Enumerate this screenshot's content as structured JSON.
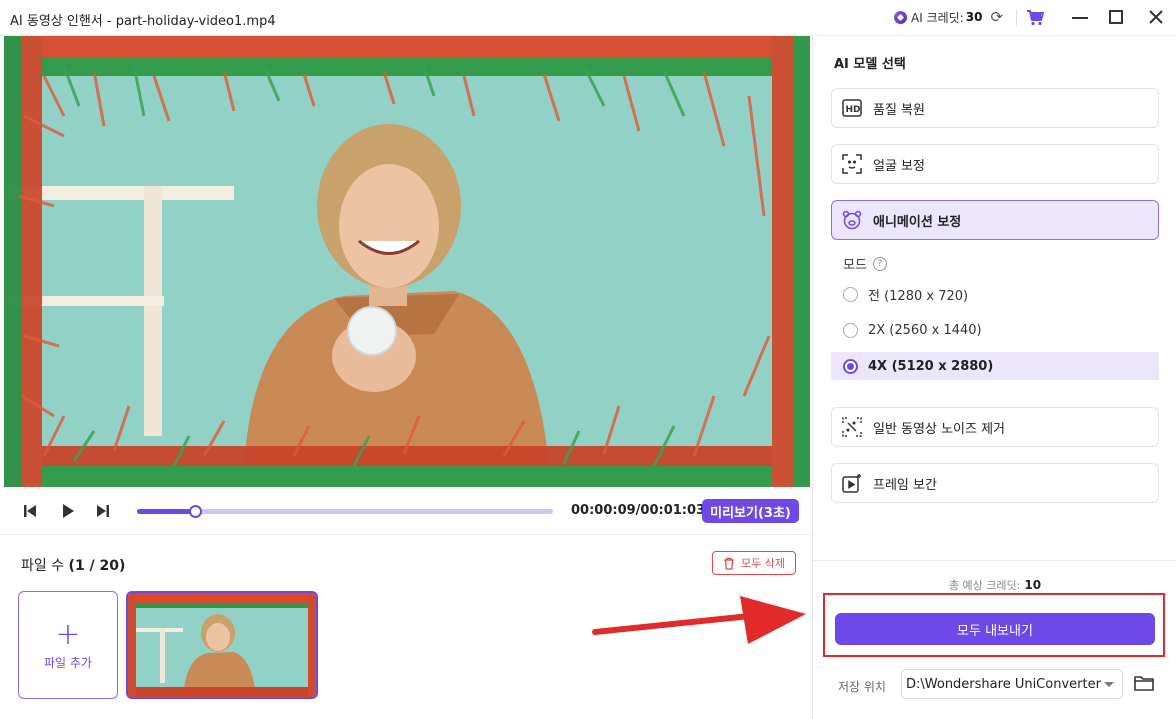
{
  "window": {
    "title": "AI 동영상 인핸서 - part-holiday-video1.mp4",
    "credit_label": "AI 크레딧:",
    "credit_value": "30"
  },
  "player": {
    "time": "00:00:09/00:01:03",
    "preview_label": "미리보기(3초)",
    "progress_fraction": 0.14
  },
  "files": {
    "count_label": "파일 수",
    "count_value": "(1 / 20)",
    "delete_all_label": "모두 삭제",
    "add_file_label": "파일 추가"
  },
  "panel": {
    "title": "AI 모델 선택",
    "models": [
      {
        "label": "품질 복원",
        "icon": "hd-icon"
      },
      {
        "label": "얼굴 보정",
        "icon": "face-scan-icon"
      },
      {
        "label": "애니메이션 보정",
        "icon": "bear-face-icon"
      },
      {
        "label": "일반 동영상 노이즈 제거",
        "icon": "denoise-icon"
      },
      {
        "label": "프레임 보간",
        "icon": "frame-interpolation-icon"
      }
    ],
    "mode_label": "모드",
    "modes": [
      {
        "label": "전 (1280 x 720)"
      },
      {
        "label": "2X (2560 x 1440)"
      },
      {
        "label": "4X (5120 x 2880)"
      }
    ],
    "selected_model": "애니메이션 보정",
    "selected_mode": "4X (5120 x 2880)",
    "estimated_credit_label": "총 예상 크레딧:",
    "estimated_credit_value": "10",
    "export_all_label": "모두 내보내기",
    "save_location_label": "저장 위치",
    "save_location_value": "D:\\Wondershare UniConverter"
  },
  "colors": {
    "accent": "#6d4ae8",
    "accent_light": "#ece6fd",
    "annotation_red": "#e12b2b"
  }
}
